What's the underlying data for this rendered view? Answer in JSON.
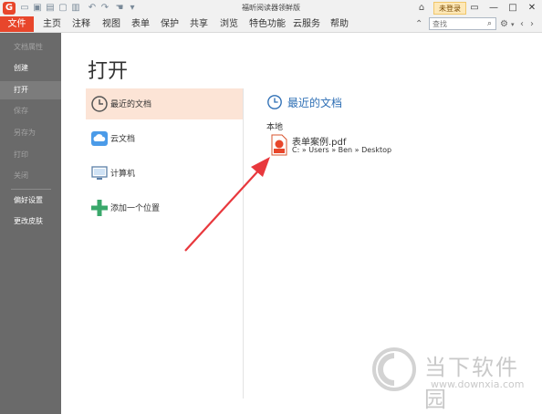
{
  "window": {
    "title": "福昕阅读器领鲜版",
    "login_label": "未登录",
    "controls": [
      "▭",
      "—",
      "□",
      "✕"
    ]
  },
  "app_logo_glyph": "G",
  "menubar": {
    "file_label": "文件",
    "items": [
      "主页",
      "注释",
      "视图",
      "表单",
      "保护",
      "共享",
      "浏览",
      "特色功能",
      "云服务",
      "帮助"
    ],
    "search_placeholder": "查找"
  },
  "sidebar": {
    "items": [
      {
        "label": "文档属性",
        "enabled": false
      },
      {
        "label": "创建",
        "enabled": true
      },
      {
        "label": "打开",
        "enabled": true,
        "active": true
      },
      {
        "label": "保存",
        "enabled": false
      },
      {
        "label": "另存为",
        "enabled": false
      },
      {
        "label": "打印",
        "enabled": false
      },
      {
        "label": "关闭",
        "enabled": false
      },
      {
        "label": "偏好设置",
        "enabled": true
      },
      {
        "label": "更改皮肤",
        "enabled": true
      }
    ]
  },
  "main": {
    "heading": "打开",
    "locations": [
      {
        "label": "最近的文档",
        "icon": "clock-icon",
        "selected": true
      },
      {
        "label": "云文档",
        "icon": "cloud-icon"
      },
      {
        "label": "计算机",
        "icon": "computer-icon"
      },
      {
        "label": "添加一个位置",
        "icon": "plus-icon"
      }
    ],
    "recent": {
      "title": "最近的文档",
      "section_label": "本地",
      "file_name": "表单案例.pdf",
      "file_path": "C: » Users » Ben » Desktop"
    }
  },
  "watermark": {
    "text": "当下软件园",
    "url": "www.downxia.com"
  },
  "colors": {
    "accent": "#e8462b",
    "sidebar": "#6a6a6a",
    "selected_bg": "#fce4d6",
    "link_blue": "#2e6fb5",
    "arrow": "#e8383d"
  }
}
